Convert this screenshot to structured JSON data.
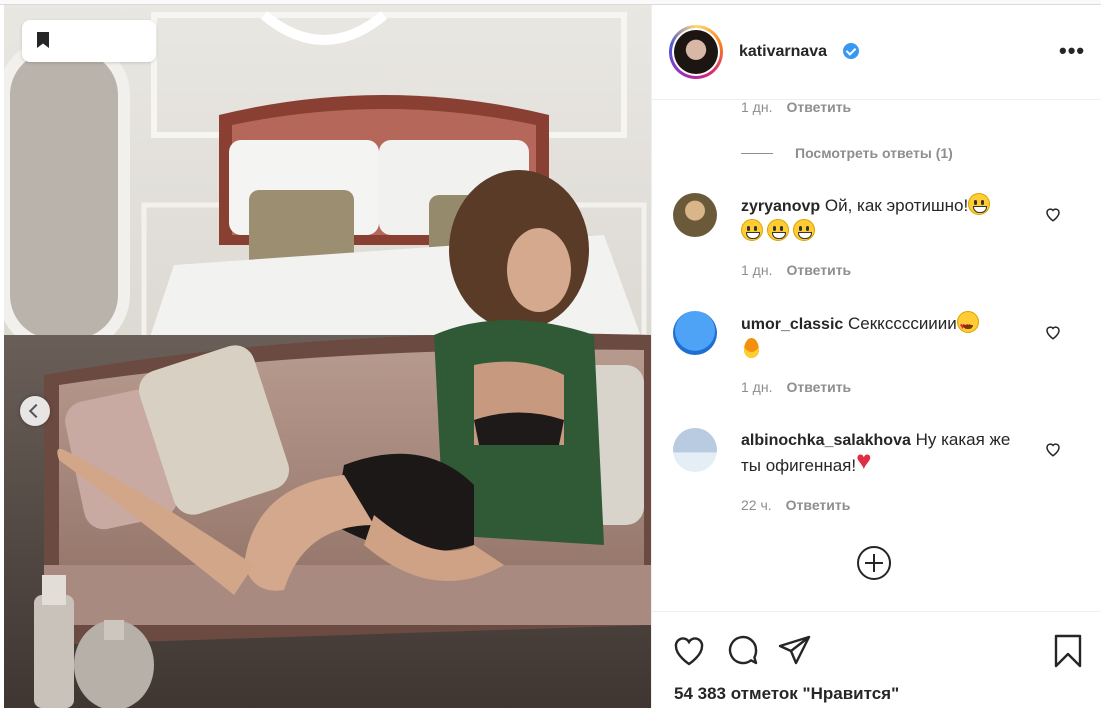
{
  "post": {
    "username": "kativarnava",
    "verified": true
  },
  "comments_panel": {
    "top_meta": {
      "time": "1 дн.",
      "reply": "Ответить"
    },
    "view_replies": "Посмотреть ответы (1)",
    "comments": [
      {
        "username": "zyryanovp",
        "text": "Ой, как эротишно!",
        "emojis": [
          "grin",
          "grin",
          "grin",
          "grin"
        ],
        "time": "1 дн.",
        "reply": "Ответить"
      },
      {
        "username": "umor_classic",
        "text": "Секкссссииии",
        "emojis": [
          "heart-eyes",
          "fire"
        ],
        "time": "1 дн.",
        "reply": "Ответить"
      },
      {
        "username": "albinochka_salakhova",
        "text": "Ну какая же ты офигенная!",
        "emojis": [
          "red-heart"
        ],
        "time": "22 ч.",
        "reply": "Ответить"
      }
    ]
  },
  "actions": {
    "likes_text": "54 383 отметок \"Нравится\""
  },
  "icons": {
    "save": "bookmark-icon",
    "more": "more-options-icon",
    "like": "heart-icon",
    "comment": "comment-icon",
    "share": "paper-plane-icon",
    "add": "plus-circle-icon",
    "prev": "chevron-left-icon",
    "verified": "verified-badge-icon"
  },
  "colors": {
    "verified": "#3897f0",
    "meta": "#8e8e8e",
    "text": "#262626"
  }
}
